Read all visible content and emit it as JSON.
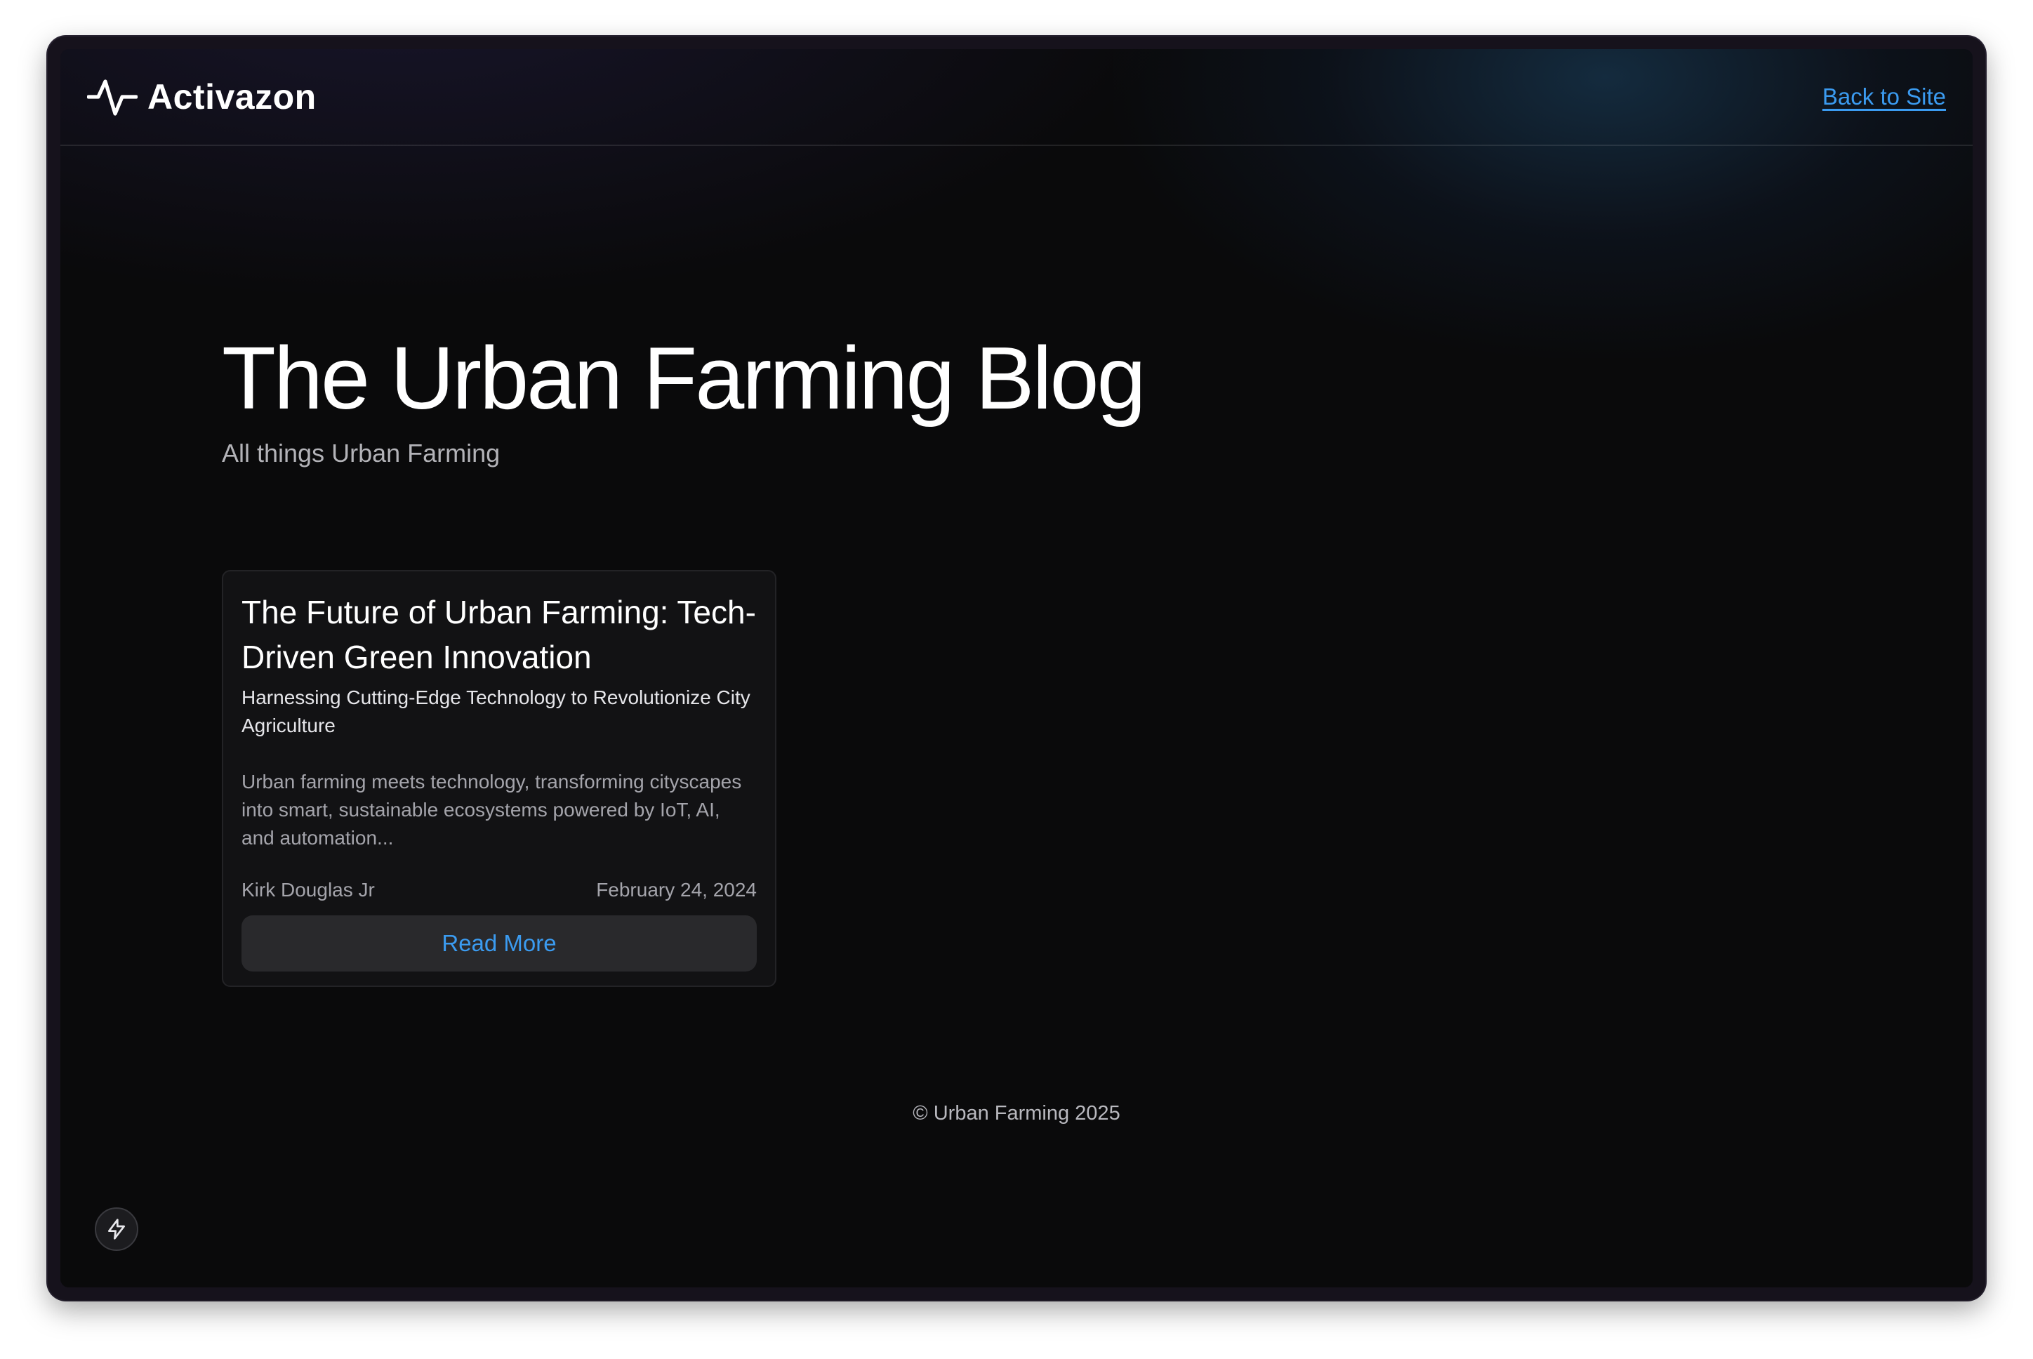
{
  "header": {
    "brand_name": "Activazon",
    "back_link": "Back to Site"
  },
  "hero": {
    "title": "The Urban Farming Blog",
    "subtitle": "All things Urban Farming"
  },
  "posts": [
    {
      "title": "The Future of Urban Farming: Tech-Driven Green Innovation",
      "subtitle": "Harnessing Cutting-Edge Technology to Revolutionize City Agriculture",
      "excerpt": "Urban farming meets technology, transforming cityscapes into smart, sustainable ecosystems powered by IoT, AI, and automation...",
      "author": "Kirk Douglas Jr",
      "date": "February 24, 2024",
      "button_label": "Read More"
    }
  ],
  "footer": {
    "copyright": "© Urban Farming 2025"
  },
  "icons": {
    "brand": "pulse-icon",
    "fab": "lightning-icon"
  },
  "colors": {
    "accent": "#3b9bf0",
    "background": "#0a0a0b",
    "card": "#121214"
  }
}
